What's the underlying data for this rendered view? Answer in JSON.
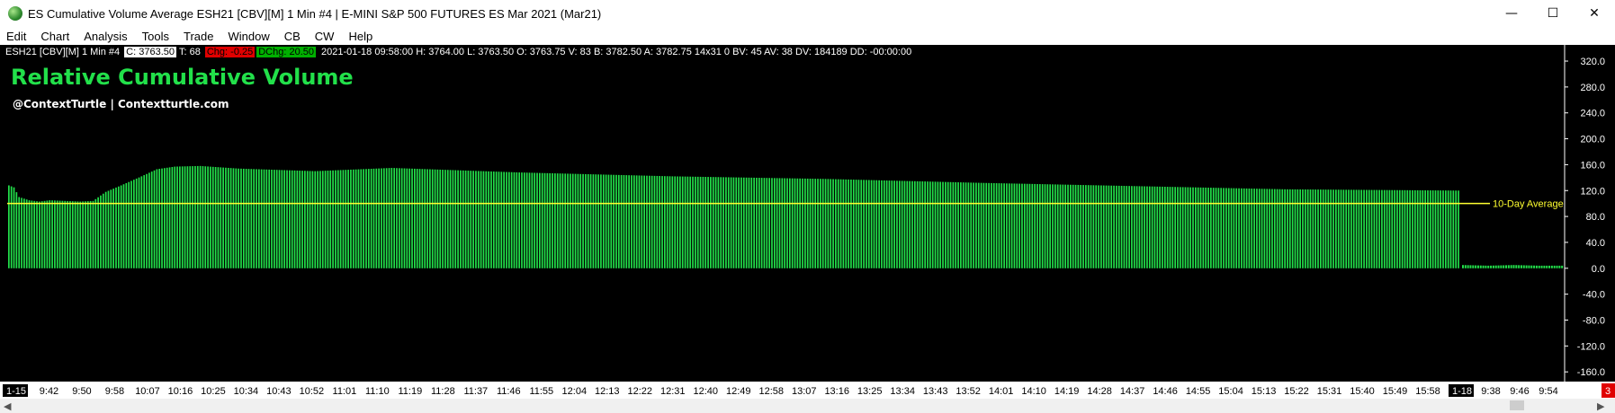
{
  "window": {
    "title": "ES Cumulative Volume Average ESH21 [CBV][M]  1 Min   #4 | E-MINI S&P 500 FUTURES ES Mar 2021 (Mar21)",
    "minimize": "—",
    "maximize": "☐",
    "close": "✕"
  },
  "menu": [
    "Edit",
    "Chart",
    "Analysis",
    "Tools",
    "Trade",
    "Window",
    "CB",
    "CW",
    "Help"
  ],
  "status": {
    "symbol": "ESH21 [CBV][M]  1 Min   #4",
    "close": "C: 3763.50",
    "ticks": "T: 68",
    "chg": "Chg: -0.25",
    "dchg": "DChg: 20.50",
    "info": "2021-01-18 09:58:00 H: 3764.00 L: 3763.50 O: 3763.75 V: 83 B: 3782.50 A: 3782.75 14x31 0 BV: 45 AV: 38 DV: 184189 DD: -00:00:00"
  },
  "chart_title": "Relative Cumulative Volume",
  "chart_subtitle": "@ContextTurtle | Contextturtle.com",
  "reference_line_label": "10-Day Average",
  "corner_badge": "3",
  "colors": {
    "bar": "#22e04a",
    "reference": "#ffff30",
    "title": "#22e04a",
    "background": "#000000"
  },
  "chart_data": {
    "type": "bar",
    "y_ticks": [
      "320.0",
      "280.0",
      "240.0",
      "200.0",
      "160.0",
      "120.0",
      "80.0",
      "40.0",
      "0.0",
      "-40.0",
      "-80.0",
      "-120.0",
      "-160.0"
    ],
    "ylim": [
      -175,
      345
    ],
    "reference_value": 100,
    "x_ticks": [
      "1-15",
      "9:42",
      "9:50",
      "9:58",
      "10:07",
      "10:16",
      "10:25",
      "10:34",
      "10:43",
      "10:52",
      "11:01",
      "11:10",
      "11:19",
      "11:28",
      "11:37",
      "11:46",
      "11:55",
      "12:04",
      "12:13",
      "12:22",
      "12:31",
      "12:40",
      "12:49",
      "12:58",
      "13:07",
      "13:16",
      "13:25",
      "13:34",
      "13:43",
      "13:52",
      "14:01",
      "14:10",
      "14:19",
      "14:28",
      "14:37",
      "14:46",
      "14:55",
      "15:04",
      "15:13",
      "15:22",
      "15:31",
      "15:40",
      "15:49",
      "15:58",
      "1-18",
      "9:38",
      "9:46",
      "9:54"
    ],
    "day1_keyframes": [
      [
        0,
        128
      ],
      [
        2,
        125
      ],
      [
        4,
        110
      ],
      [
        8,
        105
      ],
      [
        12,
        103
      ],
      [
        16,
        105
      ],
      [
        28,
        103
      ],
      [
        33,
        104
      ],
      [
        38,
        118
      ],
      [
        44,
        128
      ],
      [
        52,
        142
      ],
      [
        58,
        153
      ],
      [
        65,
        157
      ],
      [
        75,
        158
      ],
      [
        90,
        154
      ],
      [
        120,
        150
      ],
      [
        150,
        155
      ],
      [
        200,
        148
      ],
      [
        260,
        142
      ],
      [
        320,
        138
      ],
      [
        380,
        132
      ],
      [
        440,
        127
      ],
      [
        500,
        122
      ],
      [
        568,
        120
      ]
    ],
    "day1_bar_count": 569,
    "day2_keyframes": [
      [
        0,
        5
      ],
      [
        10,
        4
      ],
      [
        20,
        5
      ],
      [
        30,
        4
      ],
      [
        39,
        4
      ]
    ],
    "day2_bar_count": 40
  }
}
